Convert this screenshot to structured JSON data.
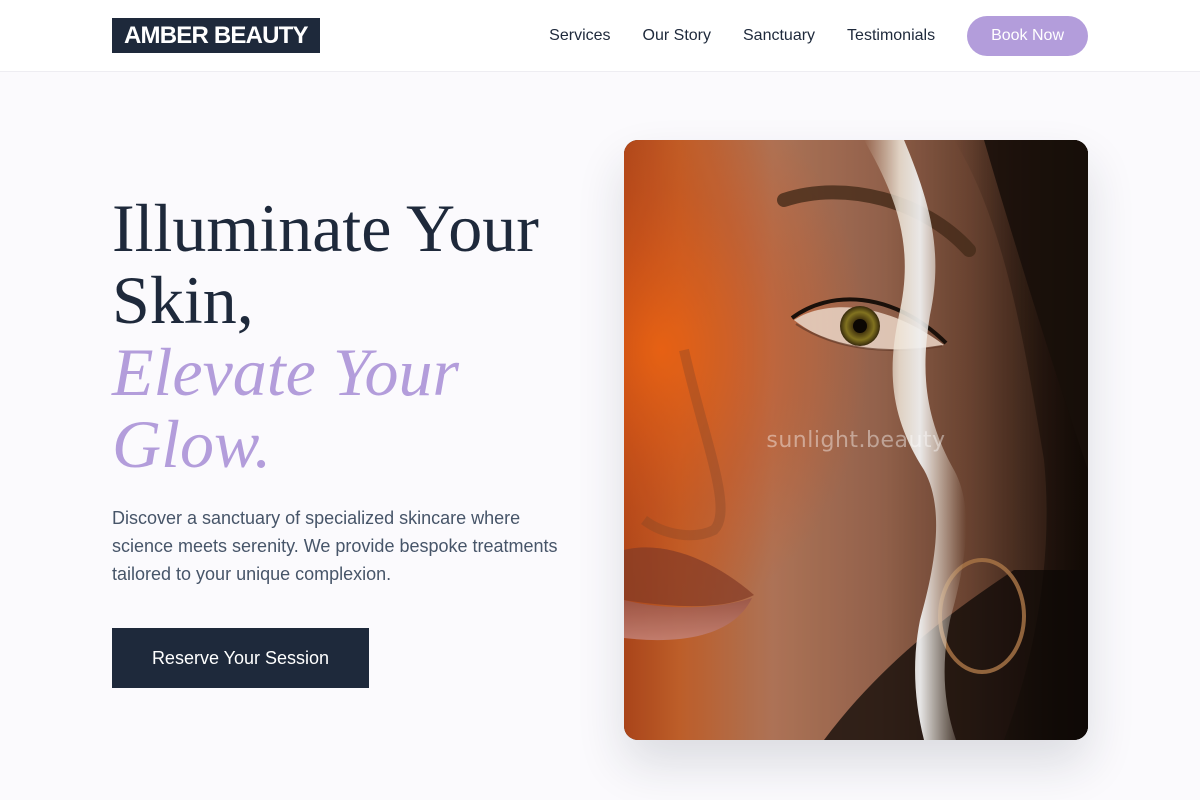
{
  "brand": {
    "logo_text": "AMBER BEAUTY"
  },
  "nav": {
    "links": [
      "Services",
      "Our Story",
      "Sanctuary",
      "Testimonials"
    ],
    "book_label": "Book Now"
  },
  "hero": {
    "title_line1": "Illuminate Your Skin,",
    "title_line2": "Elevate Your Glow.",
    "description": "Discover a sanctuary of specialized skincare where science meets serenity. We provide bespoke treatments tailored to your unique complexion.",
    "cta_label": "Reserve Your Session",
    "image_watermark": "sunlight.beauty",
    "image_subject": "close-up portrait of a woman with a beam of sunlight across her face"
  },
  "colors": {
    "dark": "#1e293b",
    "accent": "#b39ddb",
    "body_text": "#475569",
    "background": "#fbfafd"
  }
}
